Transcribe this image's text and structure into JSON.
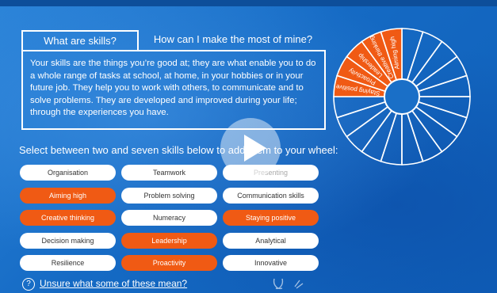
{
  "tabs": [
    {
      "label": "What are skills?"
    },
    {
      "label": "How can I make the most of mine?"
    }
  ],
  "description": "Your skills are the things you’re good at; they are what enable you to do a whole range of tasks at school, at home, in your hobbies or in your future job. They help you to work with others, to communicate and to solve problems. They are developed and improved during your life; through the experiences you have.",
  "select_label": "Select between two and seven skills below to add them to your wheel:",
  "skills": [
    {
      "label": "Organisation",
      "state": "default"
    },
    {
      "label": "Teamwork",
      "state": "default"
    },
    {
      "label": "Presenting",
      "state": "disabled"
    },
    {
      "label": "Aiming high",
      "state": "selected"
    },
    {
      "label": "Problem solving",
      "state": "default"
    },
    {
      "label": "Communication skills",
      "state": "default"
    },
    {
      "label": "Creative thinking",
      "state": "selected"
    },
    {
      "label": "Numeracy",
      "state": "default"
    },
    {
      "label": "Staying positive",
      "state": "selected"
    },
    {
      "label": "Decision making",
      "state": "default"
    },
    {
      "label": "Leadership",
      "state": "selected"
    },
    {
      "label": "Analytical",
      "state": "default"
    },
    {
      "label": "Resilience",
      "state": "default"
    },
    {
      "label": "Proactivity",
      "state": "selected"
    },
    {
      "label": "Innovative",
      "state": "default"
    }
  ],
  "wheel": {
    "segments": [
      "Aiming high",
      "Creative thinking",
      "Leadership",
      "Proactivity",
      "Staying positive"
    ],
    "segment_color": "#f05a14"
  },
  "help": {
    "icon": "?",
    "link": "Unsure what some of these mean?"
  },
  "colors": {
    "accent": "#f05a14",
    "background": "#1a6fc7"
  }
}
